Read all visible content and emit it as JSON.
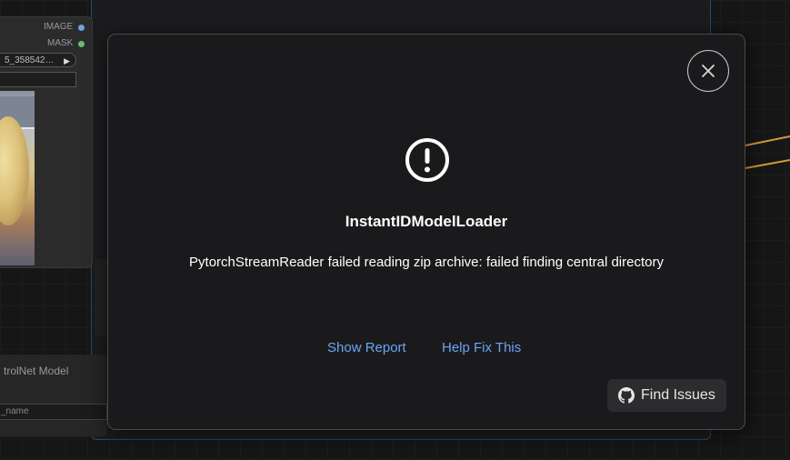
{
  "background": {
    "node_outputs": [
      "IMAGE",
      "MASK"
    ],
    "file_name": "5_358542…",
    "controlnet_title": "trolNet Model",
    "controlnet_widget": "_name"
  },
  "dialog": {
    "title": "InstantIDModelLoader",
    "message": "PytorchStreamReader failed reading zip archive: failed finding central directory",
    "show_report_label": "Show Report",
    "help_fix_label": "Help Fix This",
    "find_issues_label": "Find Issues",
    "icons": {
      "close": "close-icon",
      "alert": "exclamation-circle-icon",
      "github": "github-icon"
    }
  },
  "colors": {
    "link": "#6aa6f2",
    "image_socket": "#6fa3e0",
    "mask_socket": "#6dbf6d",
    "wire_orange": "#d49a35",
    "wire_purple": "#b8a7e8"
  }
}
